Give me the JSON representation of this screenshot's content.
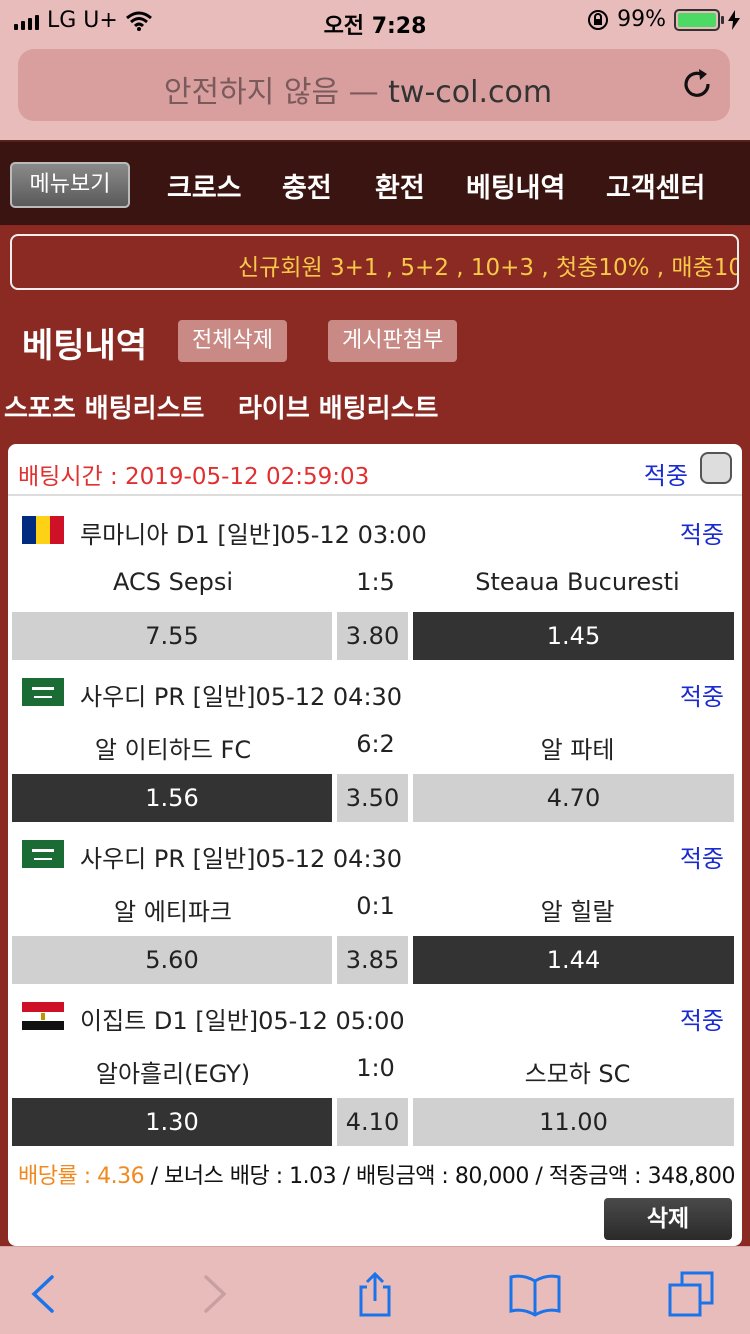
{
  "status_bar": {
    "carrier": "LG U+",
    "time": "오전 7:28",
    "battery_percent": "99%",
    "battery_level": 0.99
  },
  "browser": {
    "url_prefix": "안전하지 않음 —",
    "url_domain": "tw-col.com"
  },
  "menu": {
    "menu_button": "메뉴보기",
    "items": [
      "크로스",
      "충전",
      "환전",
      "베팅내역",
      "고객센터"
    ]
  },
  "notice": {
    "text": "신규회원 3+1 , 5+2 , 10+3 , 첫충10% , 매충10"
  },
  "page": {
    "title": "베팅내역",
    "delete_all": "전체삭제",
    "attach_board": "게시판첨부",
    "tab_sports": "스포츠 배팅리스트",
    "tab_live": "라이브 배팅리스트"
  },
  "bet": {
    "time": "배팅시간 : 2019-05-12 02:59:03",
    "result": "적중",
    "matches": [
      {
        "flag": "romania-flag-icon",
        "league": "루마니아 D1 [일반]05-12 03:00",
        "result": "적중",
        "home": "ACS Sepsi",
        "score": "1:5",
        "away": "Steaua Bucuresti",
        "odds_home": "7.55",
        "odds_draw": "3.80",
        "odds_away": "1.45",
        "selected": "away"
      },
      {
        "flag": "saudi-flag-icon",
        "league": "사우디 PR [일반]05-12 04:30",
        "result": "적중",
        "home": "알 이티하드 FC",
        "score": "6:2",
        "away": "알 파테",
        "odds_home": "1.56",
        "odds_draw": "3.50",
        "odds_away": "4.70",
        "selected": "home"
      },
      {
        "flag": "saudi-flag-icon",
        "league": "사우디 PR [일반]05-12 04:30",
        "result": "적중",
        "home": "알 에티파크",
        "score": "0:1",
        "away": "알 힐랄",
        "odds_home": "5.60",
        "odds_draw": "3.85",
        "odds_away": "1.44",
        "selected": "away"
      },
      {
        "flag": "egypt-flag-icon",
        "league": "이집트 D1 [일반]05-12 05:00",
        "result": "적중",
        "home": "알아흘리(EGY)",
        "score": "1:0",
        "away": "스모하 SC",
        "odds_home": "1.30",
        "odds_draw": "4.10",
        "odds_away": "11.00",
        "selected": "home"
      }
    ],
    "summary_odds": "배당률 : 4.36",
    "summary_rest": " / 보너스 배당 : 1.03 / 배팅금액 : 80,000 / 적중금액 : 348,800",
    "delete_button": "삭제"
  },
  "colors": {
    "background": "#8a2a22",
    "hit": "#1a2bd0",
    "bet_time": "#e03030",
    "notice": "#f7c948"
  }
}
